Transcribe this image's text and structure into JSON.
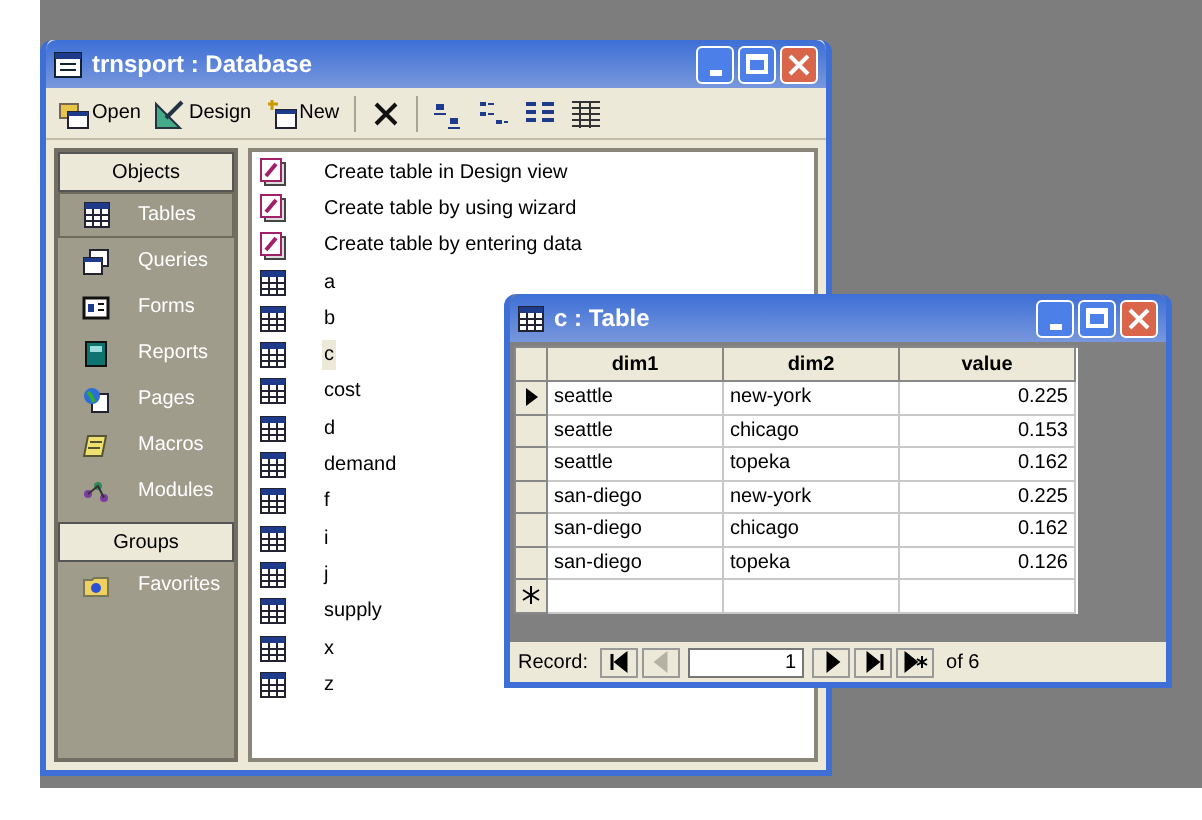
{
  "db_window": {
    "title": "trnsport : Database",
    "toolbar": [
      {
        "kind": "open",
        "label": "Open"
      },
      {
        "kind": "design",
        "label": "Design"
      },
      {
        "kind": "new",
        "label": "New"
      },
      {
        "kind": "delete"
      },
      {
        "kind": "large-icons"
      },
      {
        "kind": "small-icons"
      },
      {
        "kind": "list"
      },
      {
        "kind": "details"
      }
    ],
    "objects_header": "Objects",
    "objects": [
      {
        "kind": "tables",
        "label": "Tables",
        "selected": true
      },
      {
        "kind": "queries",
        "label": "Queries",
        "selected": false
      },
      {
        "kind": "forms",
        "label": "Forms",
        "selected": false
      },
      {
        "kind": "reports",
        "label": "Reports",
        "selected": false
      },
      {
        "kind": "pages",
        "label": "Pages",
        "selected": false
      },
      {
        "kind": "macros",
        "label": "Macros",
        "selected": false
      },
      {
        "kind": "modules",
        "label": "Modules",
        "selected": false
      }
    ],
    "groups_header": "Groups",
    "groups": [
      {
        "kind": "favorites",
        "label": "Favorites",
        "selected": false
      }
    ],
    "items": [
      {
        "kind": "shortcut",
        "label": "Create table in Design view",
        "selected": false
      },
      {
        "kind": "shortcut",
        "label": "Create table by using wizard",
        "selected": false
      },
      {
        "kind": "shortcut",
        "label": "Create table by entering data",
        "selected": false
      },
      {
        "kind": "table",
        "label": "a",
        "selected": false
      },
      {
        "kind": "table",
        "label": "b",
        "selected": false
      },
      {
        "kind": "table",
        "label": "c",
        "selected": true
      },
      {
        "kind": "table",
        "label": "cost",
        "selected": false
      },
      {
        "kind": "table",
        "label": "d",
        "selected": false
      },
      {
        "kind": "table",
        "label": "demand",
        "selected": false
      },
      {
        "kind": "table",
        "label": "f",
        "selected": false
      },
      {
        "kind": "table",
        "label": "i",
        "selected": false
      },
      {
        "kind": "table",
        "label": "j",
        "selected": false
      },
      {
        "kind": "table",
        "label": "supply",
        "selected": false
      },
      {
        "kind": "table",
        "label": "x",
        "selected": false
      },
      {
        "kind": "table",
        "label": "z",
        "selected": false
      }
    ]
  },
  "table_window": {
    "title": "c : Table",
    "columns": [
      "dim1",
      "dim2",
      "value"
    ],
    "rows": [
      {
        "cells": [
          "seattle",
          "new-york",
          "0.225"
        ],
        "current": true
      },
      {
        "cells": [
          "seattle",
          "chicago",
          "0.153"
        ],
        "current": false
      },
      {
        "cells": [
          "seattle",
          "topeka",
          "0.162"
        ],
        "current": false
      },
      {
        "cells": [
          "san-diego",
          "new-york",
          "0.225"
        ],
        "current": false
      },
      {
        "cells": [
          "san-diego",
          "chicago",
          "0.162"
        ],
        "current": false
      },
      {
        "cells": [
          "san-diego",
          "topeka",
          "0.126"
        ],
        "current": false
      }
    ],
    "navigator": {
      "label": "Record:",
      "record": "1",
      "total": "of 6",
      "buttons": [
        {
          "kind": "first",
          "disabled": false
        },
        {
          "kind": "previous",
          "disabled": true
        },
        {
          "kind": "next",
          "disabled": false
        },
        {
          "kind": "last",
          "disabled": false
        },
        {
          "kind": "new",
          "disabled": false
        }
      ]
    }
  }
}
